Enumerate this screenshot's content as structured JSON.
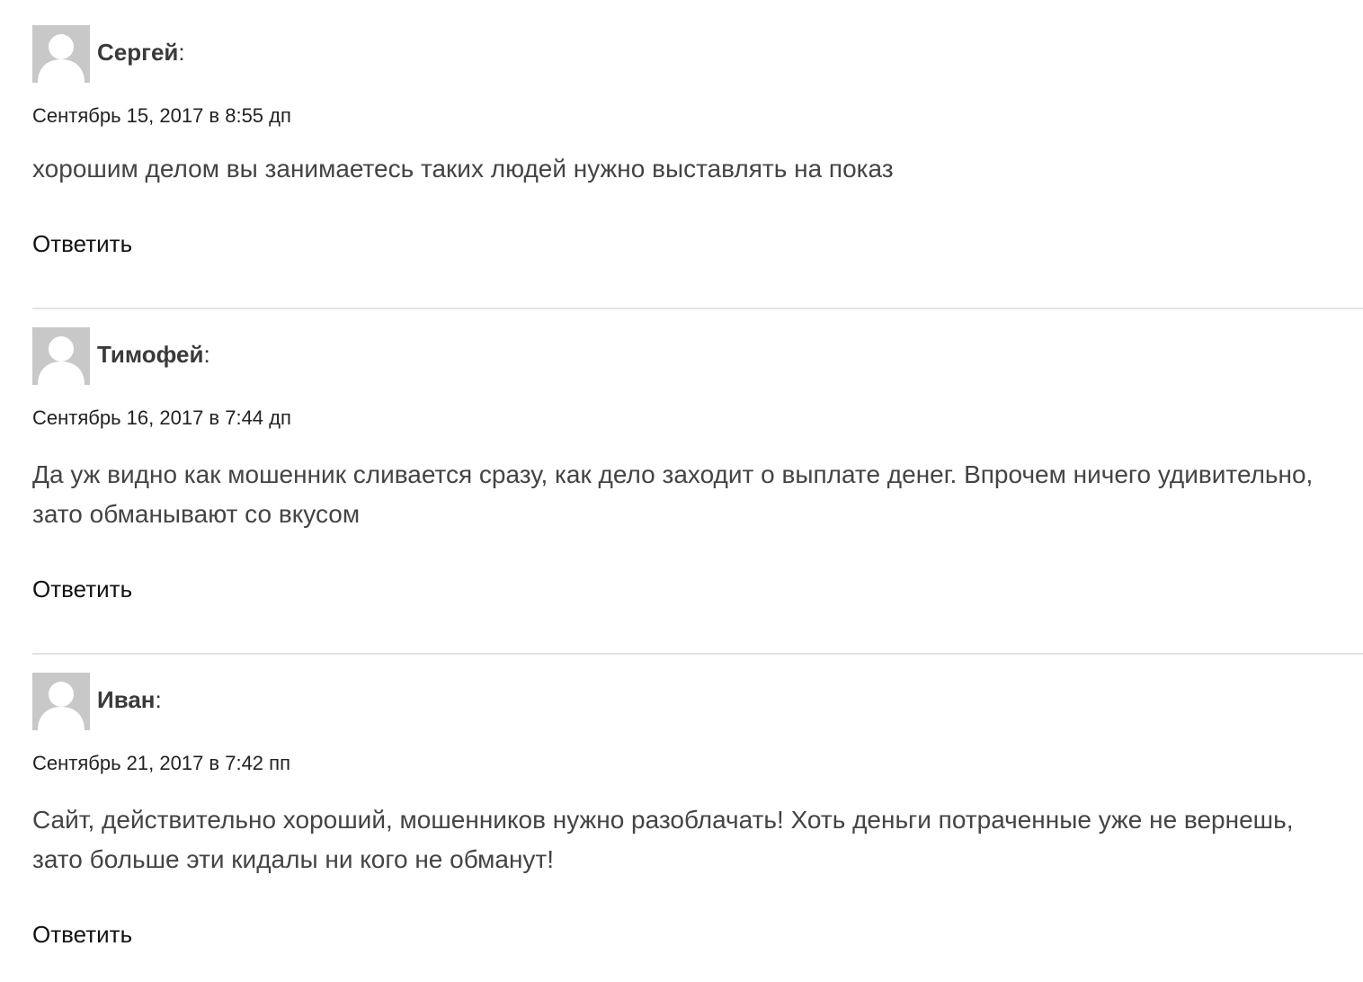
{
  "comments": [
    {
      "author": "Сергей",
      "says": ":",
      "date": "Сентябрь 15, 2017 в 8:55 дп",
      "text": "хорошим делом вы занимаетесь таких людей нужно выставлять на показ",
      "reply_label": "Ответить",
      "avatar_icon": "default-user-avatar-icon"
    },
    {
      "author": "Тимофей",
      "says": ":",
      "date": "Сентябрь 16, 2017 в 7:44 дп",
      "text": "Да уж видно как мошенник сливается сразу, как дело заходит о выплате денег. Впрочем ничего удивительно, зато обманывают со вкусом",
      "reply_label": "Ответить",
      "avatar_icon": "default-user-avatar-icon"
    },
    {
      "author": "Иван",
      "says": ":",
      "date": "Сентябрь 21, 2017 в 7:42 пп",
      "text": "Сайт, действительно хороший, мошенников нужно разоблачать! Хоть деньги потраченные уже не вернешь, зато больше эти кидалы ни кого не обманут!",
      "reply_label": "Ответить",
      "avatar_icon": "default-user-avatar-icon"
    }
  ],
  "colors": {
    "avatar_bg": "#c8c8c8",
    "avatar_figure": "#ffffff",
    "divider": "#e3e3e3",
    "body_text": "#444444",
    "author_text": "#3a3a3a"
  }
}
